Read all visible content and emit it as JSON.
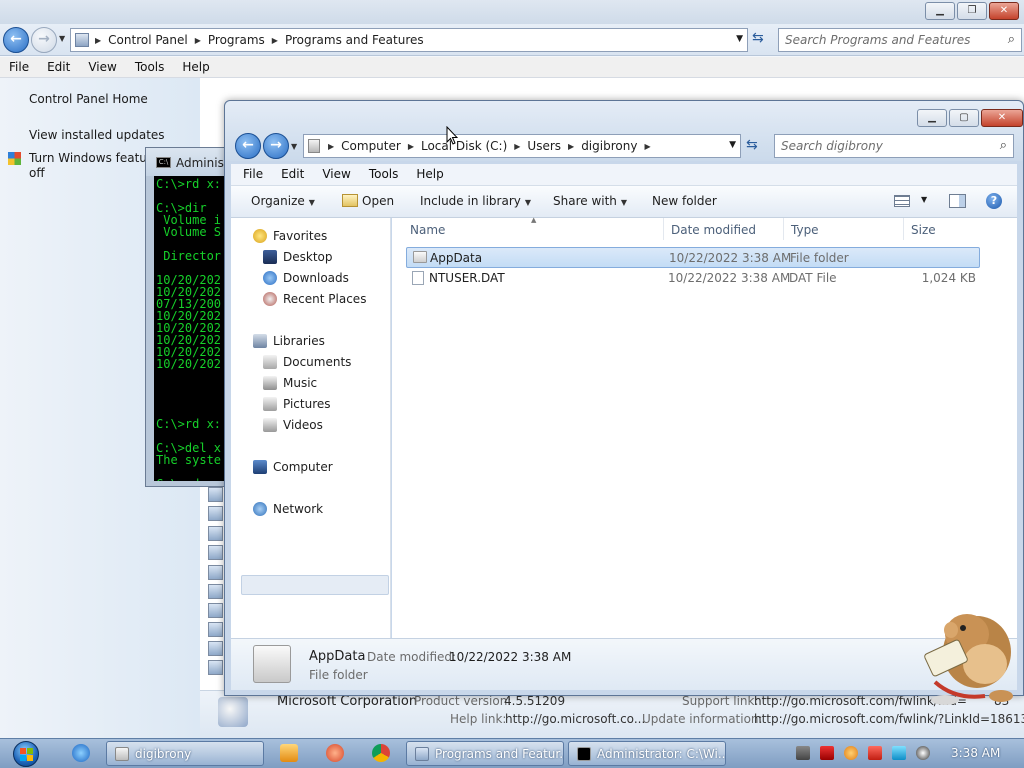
{
  "background_window": {
    "address_crumbs": [
      "Control Panel",
      "Programs",
      "Programs and Features"
    ],
    "search_placeholder": "Search Programs and Features",
    "menu": [
      "File",
      "Edit",
      "View",
      "Tools",
      "Help"
    ],
    "left_links": {
      "home": "Control Panel Home",
      "updates": "View installed updates",
      "features_line1": "Turn Windows feature",
      "features_line2": "off"
    },
    "footer": {
      "publisher": "Microsoft Corporation",
      "product_version_label": "Product version:",
      "product_version": "4.5.51209",
      "support_link_label": "Support link:",
      "support_link": "http://go.microsoft.com/fwlink/...d=",
      "support_link_tail": "83",
      "help_link_label": "Help link:",
      "help_link": "http://go.microsoft.co...",
      "update_info_label": "Update information:",
      "update_info": "http://go.microsoft.com/fwlink/?LinkId=186134"
    }
  },
  "cmd_window": {
    "title": "Administ",
    "lines": [
      "C:\\>rd x:",
      "",
      "C:\\>dir",
      " Volume i",
      " Volume S",
      "",
      " Director",
      "",
      "10/20/202",
      "10/20/202",
      "07/13/200",
      "10/20/202",
      "10/20/202",
      "10/20/202",
      "10/20/202",
      "10/20/202",
      "",
      "",
      "",
      "",
      "C:\\>rd x:",
      "",
      "C:\\>del x",
      "The syste",
      "",
      "C:\\>rd x:"
    ]
  },
  "explorer": {
    "address_crumbs": [
      "Computer",
      "Local Disk (C:)",
      "Users",
      "digibrony"
    ],
    "search_placeholder": "Search digibrony",
    "menu": [
      "File",
      "Edit",
      "View",
      "Tools",
      "Help"
    ],
    "toolbar": {
      "organize": "Organize",
      "open": "Open",
      "include": "Include in library",
      "share": "Share with",
      "new_folder": "New folder"
    },
    "nav": {
      "favorites": "Favorites",
      "desktop": "Desktop",
      "downloads": "Downloads",
      "recent": "Recent Places",
      "libraries": "Libraries",
      "documents": "Documents",
      "music": "Music",
      "pictures": "Pictures",
      "videos": "Videos",
      "computer": "Computer",
      "network": "Network"
    },
    "columns": [
      "Name",
      "Date modified",
      "Type",
      "Size"
    ],
    "files": [
      {
        "name": "AppData",
        "date": "10/22/2022 3:38 AM",
        "type": "File folder",
        "size": ""
      },
      {
        "name": "NTUSER.DAT",
        "date": "10/22/2022 3:38 AM",
        "type": "DAT File",
        "size": "1,024 KB"
      }
    ],
    "details": {
      "name": "AppData",
      "modified_label": "Date modified:",
      "modified": "10/22/2022 3:38 AM",
      "type": "File folder"
    }
  },
  "taskbar": {
    "buttons": [
      "digibrony",
      "Programs and Featur...",
      "Administrator: C:\\Wi..."
    ],
    "clock": "3:38 AM"
  }
}
